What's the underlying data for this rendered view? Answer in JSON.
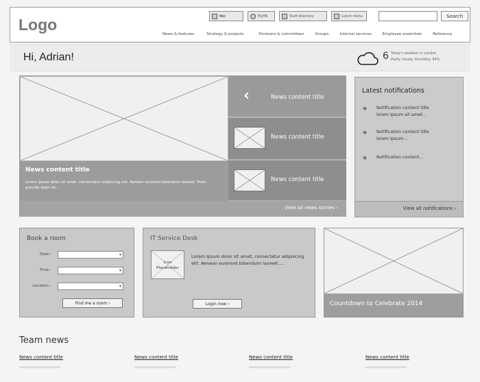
{
  "header": {
    "logo": "Logo",
    "utility_buttons": [
      {
        "label": "tbc",
        "icon": "calendar-icon"
      },
      {
        "label": "MyHR",
        "icon": "smiley-icon"
      },
      {
        "label": "Staff directory",
        "icon": "user-icon"
      },
      {
        "label": "Lunch menu",
        "icon": "heart-icon"
      }
    ],
    "search": {
      "placeholder": "",
      "button_label": "Search"
    },
    "nav": [
      "News & features",
      "Strategy & projects",
      "Divisions & committees",
      "Groups",
      "Internal services",
      "Employee essentials",
      "Reference"
    ]
  },
  "greeting": "Hi, Adrian!",
  "weather": {
    "icon": "cloud-icon",
    "temperature": "6",
    "line1": "Today's weather in London",
    "line2": "Partly cloudy. Humidity: 94%"
  },
  "news": {
    "hero_title": "News content title",
    "hero_text": "Lorem ipsum dolor sit amet, consectetur adipiscing elit. Aenean euismod bibendum laoreet. Proin gravida dolor sit...",
    "side_items": [
      "News content title",
      "News content title",
      "News content title"
    ],
    "view_all": "View all news stories ›"
  },
  "notifications": {
    "title": "Latest notifications",
    "items": [
      {
        "line1": "Notification content title",
        "line2": "lorem ipsum sit amet..."
      },
      {
        "line1": "Notification content title",
        "line2": "lorem ipsum..."
      },
      {
        "line1": "Notification content...",
        "line2": ""
      }
    ],
    "view_all": "View all notifications ›"
  },
  "book_room": {
    "title": "Book a room",
    "fields": [
      "Date :",
      "Time :",
      "Location :"
    ],
    "button": "Find me a room ›"
  },
  "it_service_desk": {
    "title": "IT Service Desk",
    "icon_placeholder_line1": "Icon",
    "icon_placeholder_line2": "Placeholder",
    "text": "Lorem ipsum dolor sit amet, consectetur adipiscing elit. Aenean euismod bibendum laoreet.....",
    "button": "Login now ›"
  },
  "countdown": {
    "label": "Countdown to Celebrate 2014"
  },
  "team_news": {
    "title": "Team news",
    "items": [
      "News content title",
      "News content title",
      "News content title",
      "News content title"
    ]
  }
}
